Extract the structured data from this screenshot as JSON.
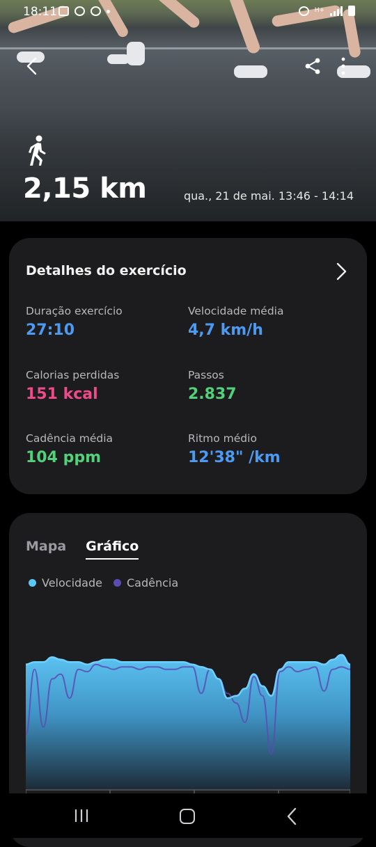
{
  "status_bar": {
    "time": "18:11"
  },
  "header": {
    "distance": "2,15 km",
    "datetime": "qua., 21 de mai. 13:46 - 14:14"
  },
  "details": {
    "title": "Detalhes do exercício",
    "stats": [
      {
        "label": "Duração exercício",
        "value": "27:10",
        "color": "#4c9af2"
      },
      {
        "label": "Velocidade média",
        "value": "4,7 km/h",
        "color": "#4c9af2"
      },
      {
        "label": "Calorias perdidas",
        "value": "151 kcal",
        "color": "#ef4b8b"
      },
      {
        "label": "Passos",
        "value": "2.837",
        "color": "#52d07a"
      },
      {
        "label": "Cadência média",
        "value": "104 ppm",
        "color": "#52d07a"
      },
      {
        "label": "Ritmo médio",
        "value": "12'38\" /km",
        "color": "#4c9af2"
      }
    ]
  },
  "chart_card": {
    "tabs": [
      {
        "label": "Mapa",
        "active": false
      },
      {
        "label": "Gráfico",
        "active": true
      }
    ],
    "legend": [
      {
        "label": "Velocidade",
        "color": "#5ac8f5"
      },
      {
        "label": "Cadência",
        "color": "#5b4bb5"
      }
    ]
  },
  "chart_data": {
    "type": "area",
    "xlabel": "",
    "ylabel": "",
    "grid": false,
    "series": [
      {
        "name": "Velocidade",
        "values": [
          5.2,
          5.3,
          5.3,
          5.5,
          5.4,
          5.3,
          5.3,
          5.2,
          5.3,
          5.4,
          5.4,
          5.3,
          5.3,
          5.3,
          5.3,
          5.3,
          5.3,
          5.3,
          5.3,
          5.2,
          5.1,
          5.0,
          4.6,
          3.8,
          3.9,
          4.2,
          4.8,
          4.3,
          3.9,
          5.0,
          5.3,
          5.3,
          5.3,
          5.3,
          5.2,
          5.4,
          5.6,
          5.2
        ]
      },
      {
        "name": "Cadência",
        "values": [
          2.3,
          5.0,
          2.6,
          4.6,
          4.8,
          3.8,
          5.0,
          4.9,
          5.2,
          5.1,
          5.0,
          5.1,
          5.1,
          5.0,
          5.1,
          5.1,
          5.0,
          5.0,
          5.1,
          5.1,
          4.0,
          5.0,
          4.6,
          4.0,
          3.6,
          2.8,
          4.7,
          3.9,
          1.5,
          4.9,
          5.1,
          4.9,
          5.0,
          5.1,
          4.1,
          5.0,
          5.1,
          5.0
        ]
      }
    ]
  },
  "nav": {
    "recent": "recent-apps",
    "home": "home",
    "back": "back"
  }
}
